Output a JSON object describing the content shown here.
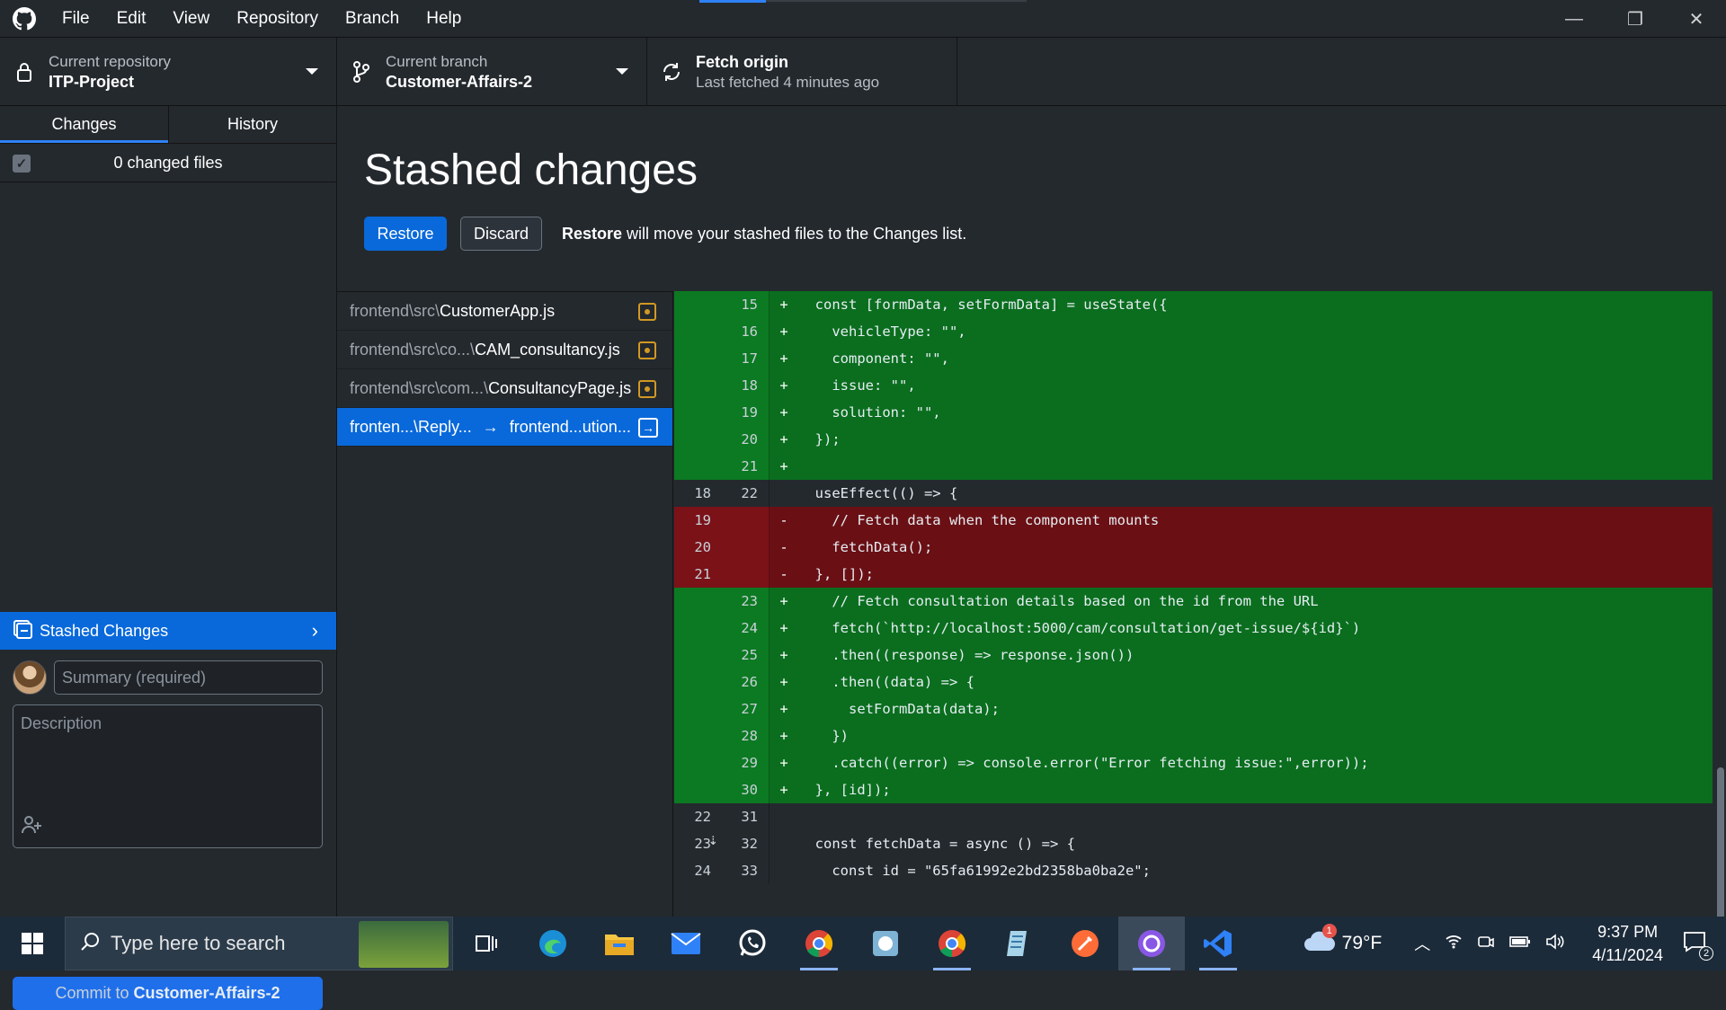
{
  "menubar": {
    "items": [
      "File",
      "Edit",
      "View",
      "Repository",
      "Branch",
      "Help"
    ],
    "window_controls": {
      "minimize": "—",
      "restore": "❐",
      "close": "✕"
    }
  },
  "toolbar": {
    "repo": {
      "title": "Current repository",
      "value": "ITP-Project"
    },
    "branch": {
      "title": "Current branch",
      "value": "Customer-Affairs-2"
    },
    "fetch": {
      "title": "Fetch origin",
      "value": "Last fetched 4 minutes ago"
    }
  },
  "sidebar": {
    "tabs": [
      {
        "label": "Changes"
      },
      {
        "label": "History"
      }
    ],
    "changed_files": "0 changed files",
    "stash_bar": "Stashed Changes",
    "summary_placeholder": "Summary (required)",
    "description_placeholder": "Description",
    "commit_prefix": "Commit to ",
    "commit_branch": "Customer-Affairs-2"
  },
  "main": {
    "title": "Stashed changes",
    "restore": "Restore",
    "discard": "Discard",
    "note_bold": "Restore",
    "note_rest": " will move your stashed files to the Changes list."
  },
  "files": [
    {
      "dir": "frontend\\src\\",
      "name": "CustomerApp.js"
    },
    {
      "dir": "frontend\\src\\co...\\",
      "name": "CAM_consultancy.js"
    },
    {
      "dir": "frontend\\src\\com...\\",
      "name": "ConsultancyPage.js"
    },
    {
      "from": "fronten...\\Reply...",
      "to": "frontend...ution..."
    }
  ],
  "diff": [
    {
      "type": "add",
      "old": "",
      "new": "15",
      "sign": "+",
      "code": "  const [formData, setFormData] = useState({"
    },
    {
      "type": "add",
      "old": "",
      "new": "16",
      "sign": "+",
      "code": "    vehicleType: \"\","
    },
    {
      "type": "add",
      "old": "",
      "new": "17",
      "sign": "+",
      "code": "    component: \"\","
    },
    {
      "type": "add",
      "old": "",
      "new": "18",
      "sign": "+",
      "code": "    issue: \"\","
    },
    {
      "type": "add",
      "old": "",
      "new": "19",
      "sign": "+",
      "code": "    solution: \"\","
    },
    {
      "type": "add",
      "old": "",
      "new": "20",
      "sign": "+",
      "code": "  });"
    },
    {
      "type": "add",
      "old": "",
      "new": "21",
      "sign": "+",
      "code": ""
    },
    {
      "type": "ctx",
      "old": "18",
      "new": "22",
      "sign": "",
      "code": "  useEffect(() => {"
    },
    {
      "type": "del",
      "old": "19",
      "new": "",
      "sign": "-",
      "code": "    // Fetch data when the component mounts"
    },
    {
      "type": "del",
      "old": "20",
      "new": "",
      "sign": "-",
      "code": "    fetchData();"
    },
    {
      "type": "del",
      "old": "21",
      "new": "",
      "sign": "-",
      "code": "  }, []);"
    },
    {
      "type": "add",
      "old": "",
      "new": "23",
      "sign": "+",
      "code": "    // Fetch consultation details based on the id from the URL"
    },
    {
      "type": "add",
      "old": "",
      "new": "24",
      "sign": "+",
      "code": "    fetch(`http://localhost:5000/cam/consultation/get-issue/${id}`)"
    },
    {
      "type": "add",
      "old": "",
      "new": "25",
      "sign": "+",
      "code": "    .then((response) => response.json())"
    },
    {
      "type": "add",
      "old": "",
      "new": "26",
      "sign": "+",
      "code": "    .then((data) => {"
    },
    {
      "type": "add",
      "old": "",
      "new": "27",
      "sign": "+",
      "code": "      setFormData(data);"
    },
    {
      "type": "add",
      "old": "",
      "new": "28",
      "sign": "+",
      "code": "    })"
    },
    {
      "type": "add",
      "old": "",
      "new": "29",
      "sign": "+",
      "code": "    .catch((error) => console.error(\"Error fetching issue:\",error));"
    },
    {
      "type": "add",
      "old": "",
      "new": "30",
      "sign": "+",
      "code": "  }, [id]);"
    },
    {
      "type": "ctx",
      "old": "22",
      "new": "31",
      "sign": "",
      "code": ""
    },
    {
      "type": "ctx",
      "old": "23",
      "new": "32",
      "sign": "",
      "code": "  const fetchData = async () => {"
    },
    {
      "type": "ctx",
      "old": "24",
      "new": "33",
      "sign": "",
      "code": "    const id = \"65fa61992e2bd2358ba0ba2e\";"
    }
  ],
  "taskbar": {
    "search_placeholder": "Type here to search",
    "weather": "79°F",
    "weather_badge": "1",
    "time": "9:37 PM",
    "date": "4/11/2024",
    "notifications": "2"
  }
}
